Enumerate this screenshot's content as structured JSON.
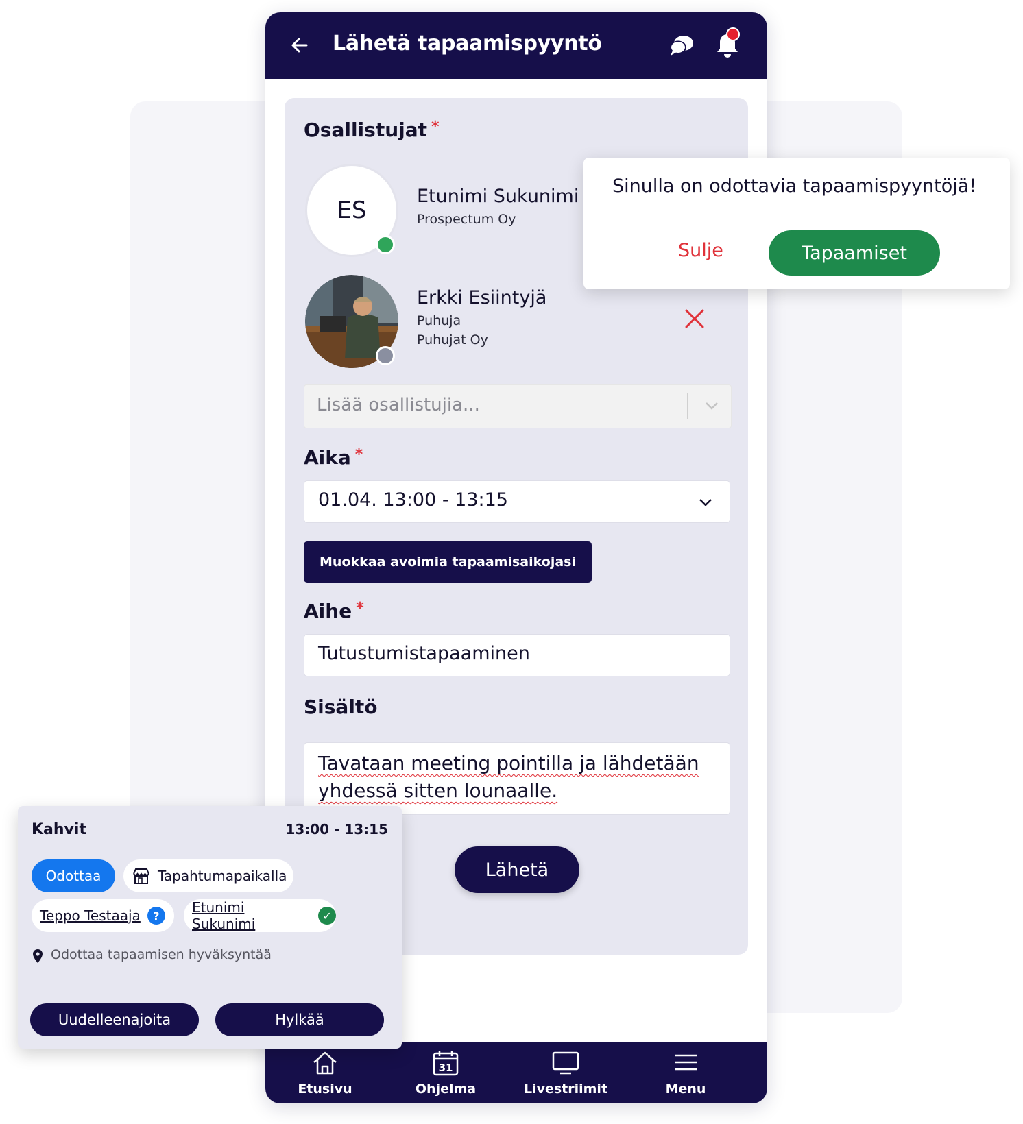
{
  "header": {
    "title": "Lähetä tapaamispyyntö"
  },
  "form": {
    "participants_label": "Osallistujat",
    "required_mark": "*",
    "participants": [
      {
        "initials": "ES",
        "name": "Etunimi Sukunimi",
        "company": "Prospectum Oy",
        "status_color": "#2fa55a"
      },
      {
        "name": "Erkki Esiintyjä",
        "role": "Puhuja",
        "company": "Puhujat Oy",
        "status_color": "#8a8fa0"
      }
    ],
    "add_participants_placeholder": "Lisää osallistujia...",
    "time_label": "Aika",
    "time_value": "01.04. 13:00 - 13:15",
    "edit_slots_button": "Muokkaa avoimia tapaamisaikojasi",
    "subject_label": "Aihe",
    "subject_value": "Tutustumistapaaminen",
    "content_label": "Sisältö",
    "content_value": "Tavataan meeting pointilla ja lähdetään yhdessä sitten lounaalle.",
    "send_button": "Lähetä"
  },
  "bottom_nav": [
    {
      "label": "Etusivu",
      "icon": "home-icon"
    },
    {
      "label": "Ohjelma",
      "icon": "calendar-icon",
      "calendar_day": "31"
    },
    {
      "label": "Livestriimit",
      "icon": "monitor-icon"
    },
    {
      "label": "Menu",
      "icon": "hamburger-icon"
    }
  ],
  "notification": {
    "text": "Sinulla on odottavia tapaamispyyntöjä!",
    "close_label": "Sulje",
    "action_label": "Tapaamiset"
  },
  "meeting_card": {
    "title": "Kahvit",
    "time": "13:00 - 13:15",
    "status_chip": "Odottaa",
    "location_chip": "Tapahtumapaikalla",
    "participants": [
      {
        "name": "Teppo Testaaja",
        "badge": "?",
        "badge_color": "#1477ee"
      },
      {
        "name": "Etunimi Sukunimi",
        "badge": "✓",
        "badge_color": "#1e8a4c"
      }
    ],
    "status_text": "Odottaa tapaamisen hyväksyntää",
    "reschedule_button": "Uudelleenajoita",
    "reject_button": "Hylkää"
  },
  "colors": {
    "navy": "#160f4a",
    "accent_red": "#e0323a",
    "green": "#1e8a4c",
    "blue": "#1477ee"
  }
}
